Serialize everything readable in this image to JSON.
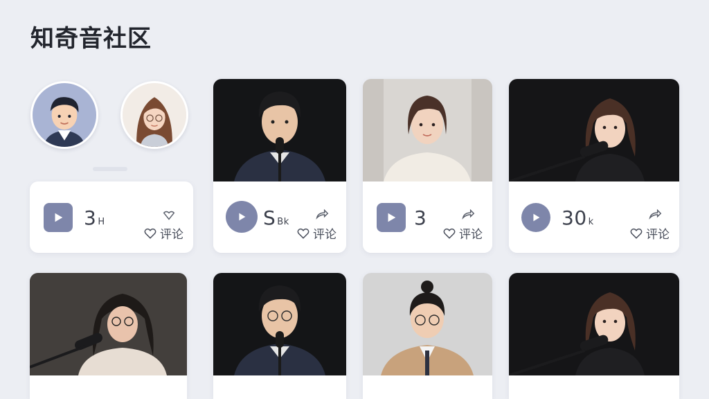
{
  "page": {
    "title": "知奇音社区"
  },
  "avatars": [
    {
      "name": "avatar-boy"
    },
    {
      "name": "avatar-girl-glasses"
    }
  ],
  "cards": [
    {
      "count": "3",
      "suffix": "H",
      "comment_label": "评论",
      "play_shape": "square",
      "share_icon": "heart-outline-icon"
    },
    {
      "count": "S",
      "suffix": "Bk",
      "comment_label": "评论",
      "play_shape": "badge",
      "share_icon": "share-arrow-icon"
    },
    {
      "count": "3",
      "suffix": "",
      "comment_label": "评论",
      "play_shape": "square",
      "share_icon": "share-arrow-icon"
    },
    {
      "count": "30",
      "suffix": "k",
      "comment_label": "评论",
      "play_shape": "round",
      "share_icon": "share-arrow-icon"
    }
  ],
  "colors": {
    "background": "#eceef3",
    "accent": "#7e86aa",
    "card": "#ffffff",
    "text": "#3b3f4b"
  }
}
